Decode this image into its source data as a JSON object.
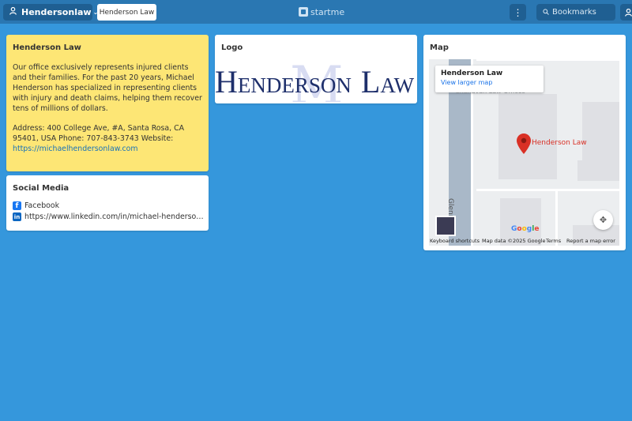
{
  "topbar": {
    "user_label": "Hendersonlaw",
    "page_tab": "Henderson Law",
    "logo_text": "startme",
    "search_placeholder": "Bookmarks"
  },
  "about": {
    "title": "Henderson Law",
    "description": "Our office exclusively represents injured clients and their families. For the past 20 years, Michael Henderson has specialized in representing clients with injury and death claims, helping them recover tens of millions of dollars.",
    "contact": "Address: 400 College Ave, #A, Santa Rosa, CA 95401, USA Phone: 707-843-3743 Website:",
    "website": "https://michaelhendersonlaw.com"
  },
  "social": {
    "title": "Social Media",
    "items": [
      {
        "label": "Facebook",
        "icon": "facebook-icon"
      },
      {
        "label": "https://www.linkedin.com/in/michael-henderson-...",
        "icon": "linkedin-icon"
      }
    ]
  },
  "logo_widget": {
    "title": "Logo",
    "logo_name_h": "H",
    "logo_name_enderson": "ENDERSON",
    "logo_name_l": "L",
    "logo_name_aw": "AW",
    "logo_monogram": "M"
  },
  "map_widget": {
    "title": "Map",
    "info_title": "Henderson Law",
    "info_link": "View larger map",
    "faded_label": "Chanavan Law Offices",
    "pin_label": "Henderson Law",
    "street": "Glenn St",
    "footer": {
      "shortcuts": "Keyboard shortcuts",
      "data": "Map data ©2025 Google",
      "terms": "Terms",
      "report": "Report a map error"
    },
    "google": "Google"
  },
  "colors": {
    "background": "#3597dc",
    "topbar": "#2a77b2",
    "note": "#fde675",
    "pin": "#d93025"
  }
}
